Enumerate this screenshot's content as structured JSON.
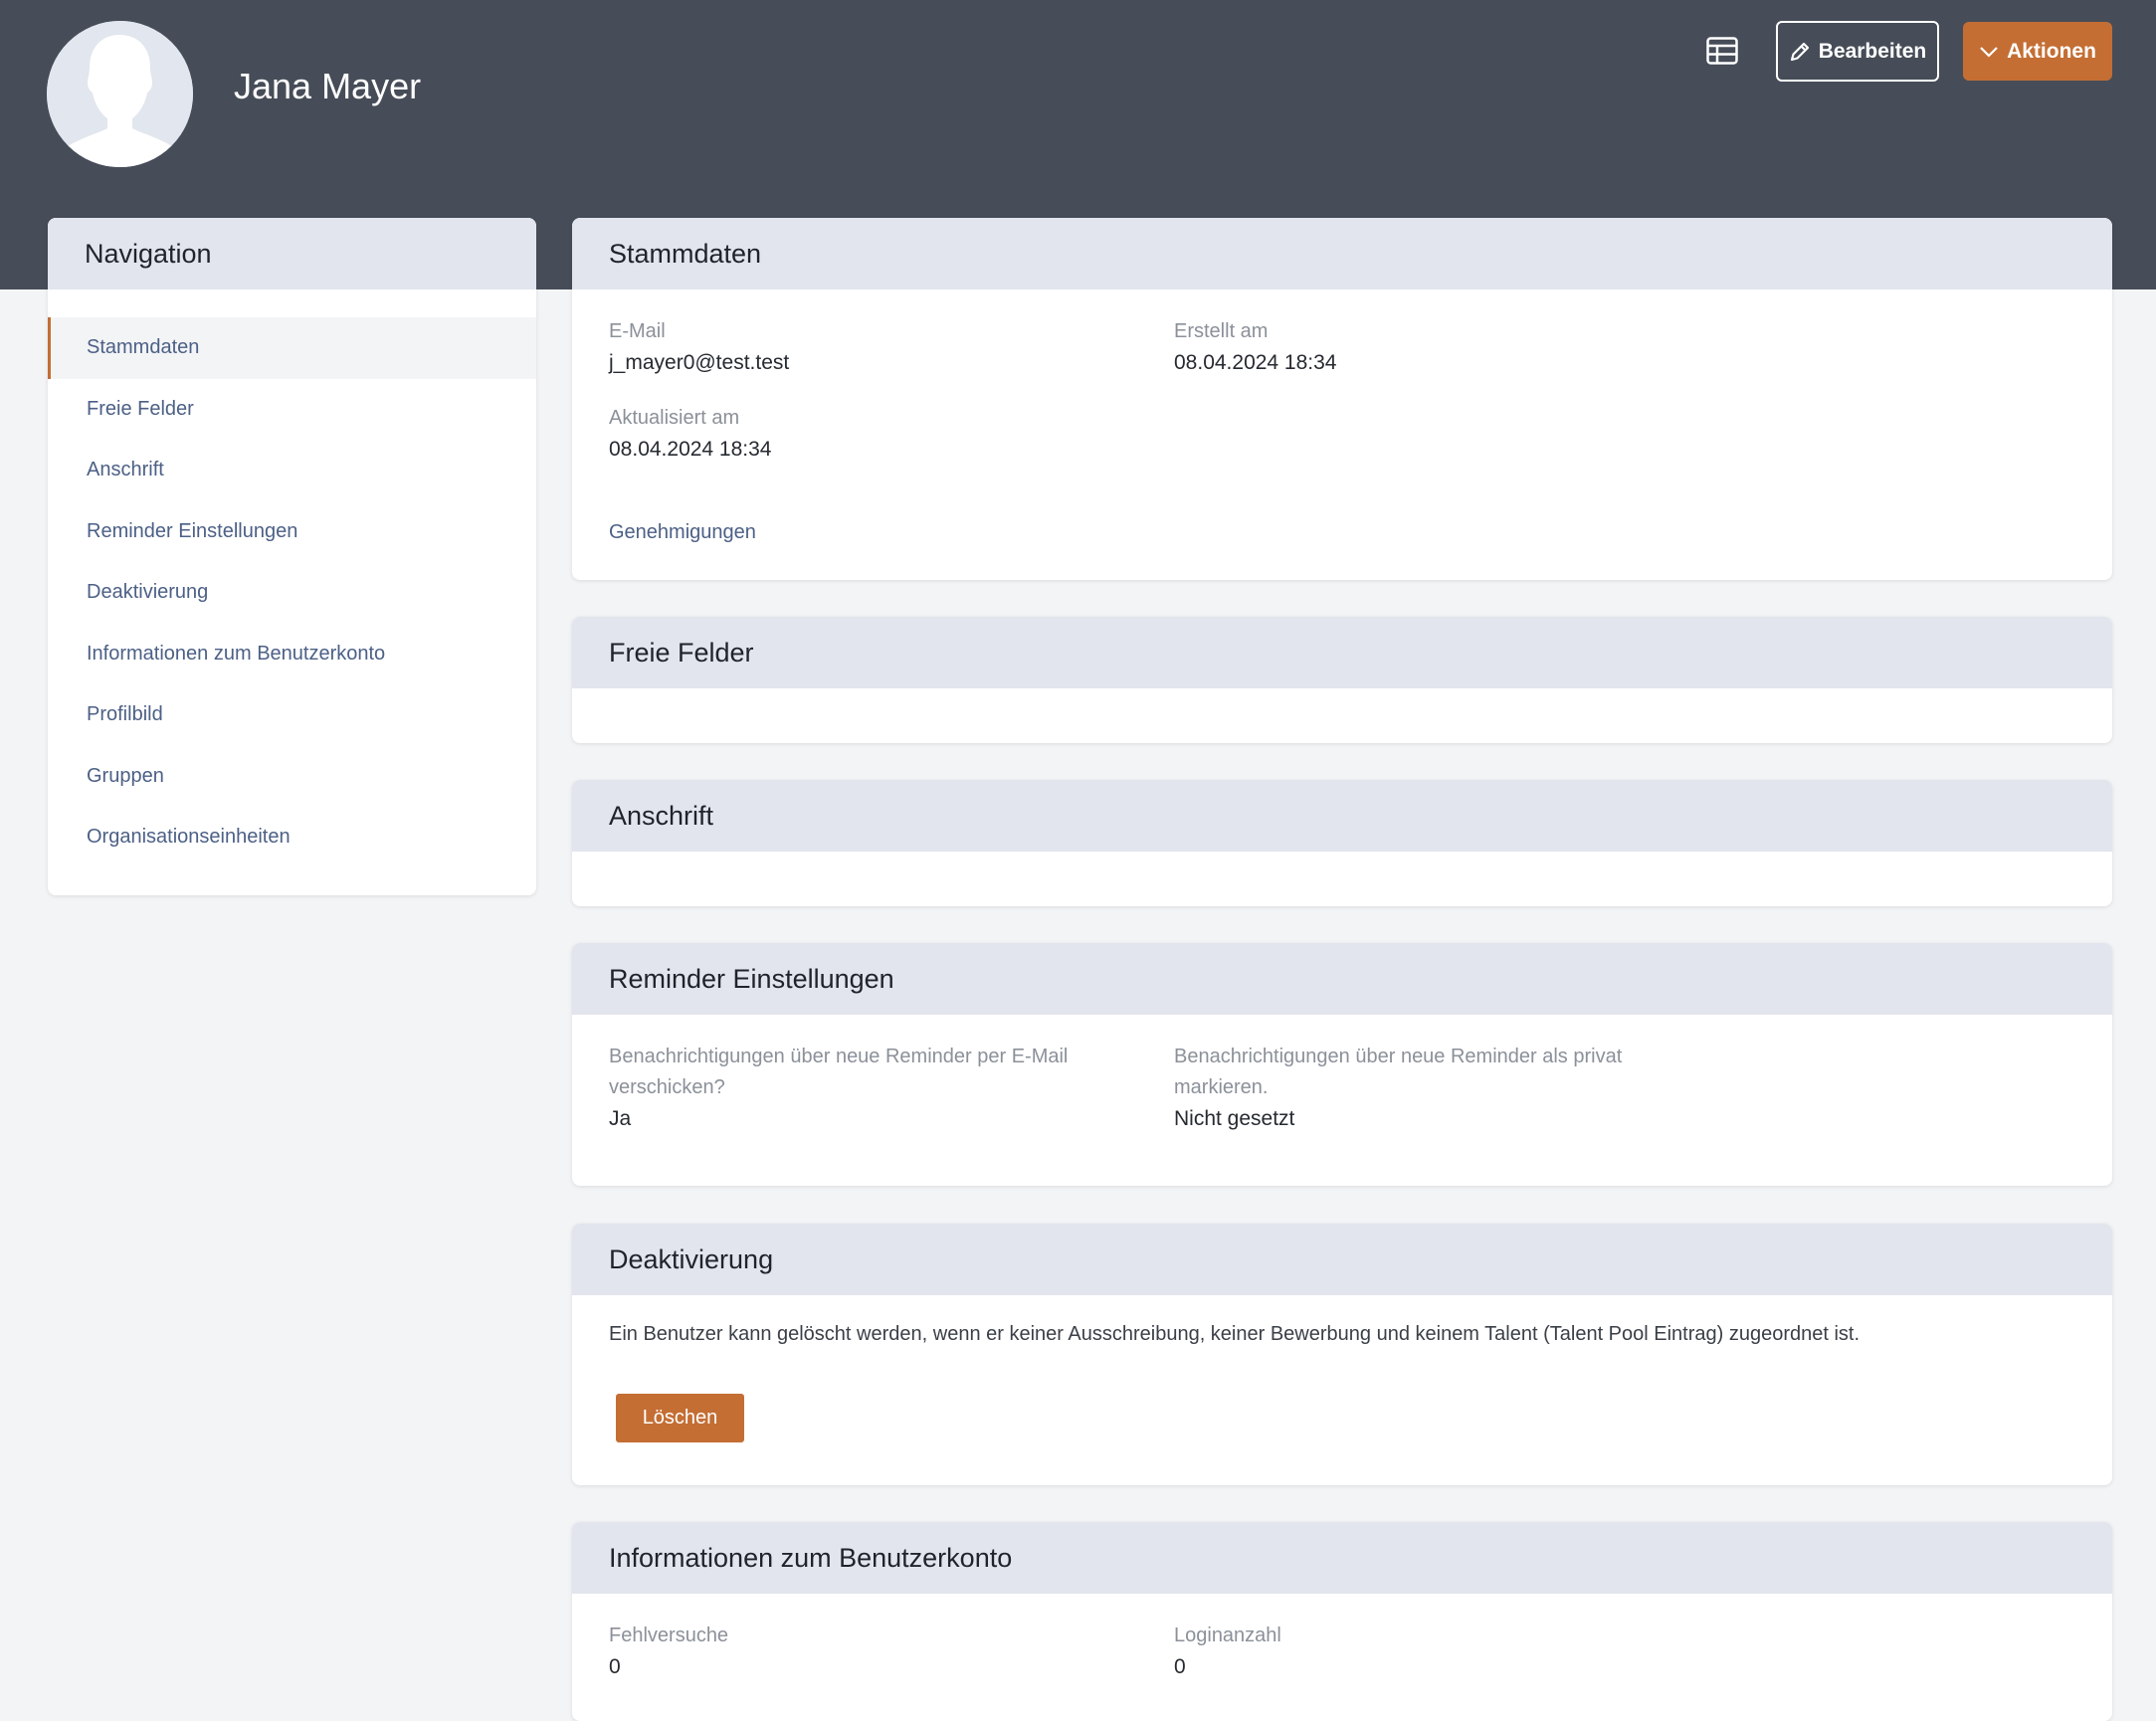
{
  "header": {
    "user_name": "Jana Mayer",
    "edit_label": "Bearbeiten",
    "actions_label": "Aktionen"
  },
  "nav": {
    "title": "Navigation",
    "items": [
      "Stammdaten",
      "Freie Felder",
      "Anschrift",
      "Reminder Einstellungen",
      "Deaktivierung",
      "Informationen zum Benutzerkonto",
      "Profilbild",
      "Gruppen",
      "Organisationseinheiten"
    ],
    "active": "Stammdaten"
  },
  "stammdaten": {
    "title": "Stammdaten",
    "email_label": "E-Mail",
    "email_value": "j_mayer0@test.test",
    "created_label": "Erstellt am",
    "created_value": "08.04.2024 18:34",
    "updated_label": "Aktualisiert am",
    "updated_value": "08.04.2024 18:34",
    "approvals_link": "Genehmigungen"
  },
  "freie_felder": {
    "title": "Freie Felder"
  },
  "anschrift": {
    "title": "Anschrift"
  },
  "reminder": {
    "title": "Reminder Einstellungen",
    "email_notify_label": "Benachrichtigungen über neue Reminder per E-Mail verschicken?",
    "email_notify_value": "Ja",
    "private_label": "Benachrichtigungen über neue Reminder als privat markieren.",
    "private_value": "Nicht gesetzt"
  },
  "deaktivierung": {
    "title": "Deaktivierung",
    "text": "Ein Benutzer kann gelöscht werden, wenn er keiner Ausschreibung, keiner Bewerbung und keinem Talent (Talent Pool Eintrag) zugeordnet ist.",
    "delete_label": "Löschen"
  },
  "benutzerkonto": {
    "title": "Informationen zum Benutzerkonto",
    "failed_label": "Fehlversuche",
    "failed_value": "0",
    "logins_label": "Loginanzahl",
    "logins_value": "0"
  },
  "colors": {
    "header_bg": "#464d58",
    "accent": "#c46e34",
    "link": "#4c6086",
    "card_head": "#e2e5ed"
  }
}
